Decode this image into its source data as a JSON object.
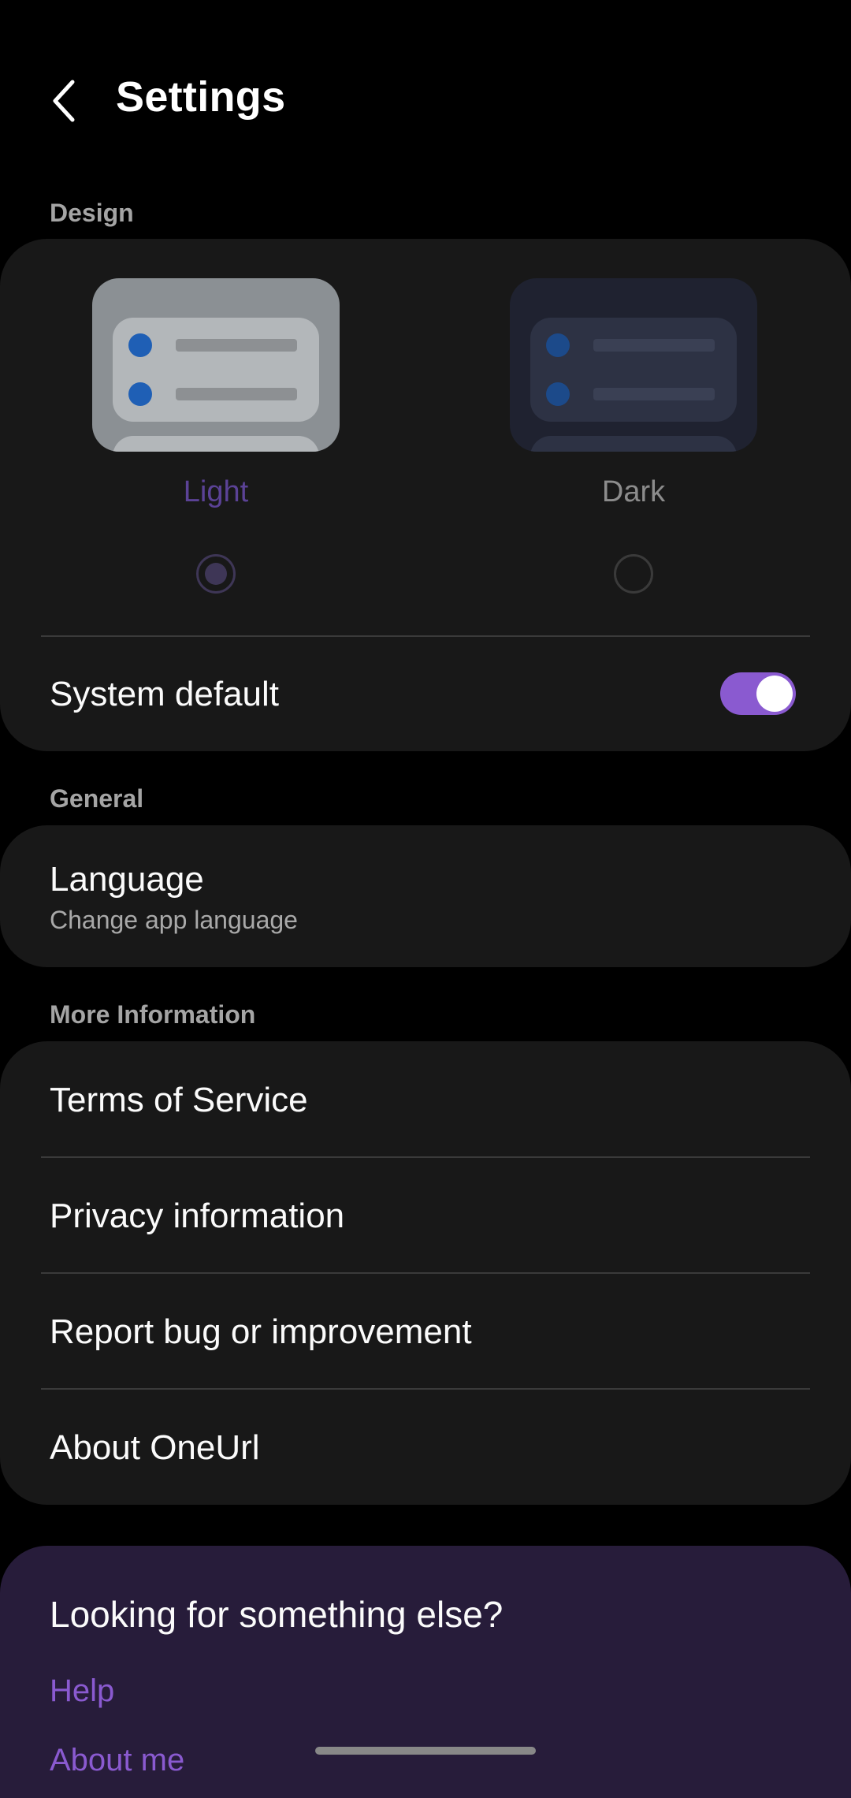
{
  "header": {
    "title": "Settings",
    "back_icon": "chevron-left-icon"
  },
  "design": {
    "section_label": "Design",
    "themes": [
      {
        "label": "Light",
        "selected": true
      },
      {
        "label": "Dark",
        "selected": false
      }
    ],
    "system_default_label": "System default",
    "system_default_on": true
  },
  "general": {
    "section_label": "General",
    "language_title": "Language",
    "language_subtitle": "Change app language"
  },
  "more_info": {
    "section_label": "More Information",
    "items": [
      "Terms of Service",
      "Privacy information",
      "Report bug or improvement",
      "About OneUrl"
    ]
  },
  "promo": {
    "heading": "Looking for something else?",
    "links": [
      "Help",
      "About me"
    ]
  },
  "colors": {
    "accent": "#8a5ad0",
    "light_label": "#5b4296",
    "card_bg": "#181818",
    "promo_bg": "#271c3a"
  }
}
